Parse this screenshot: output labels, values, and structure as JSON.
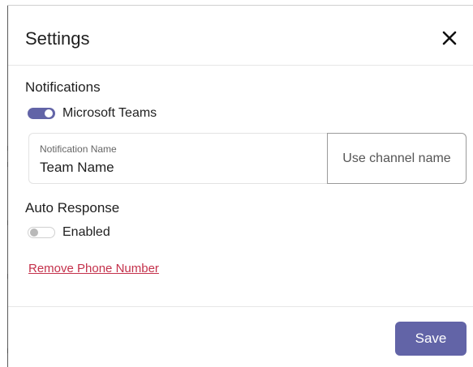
{
  "dialog": {
    "title": "Settings",
    "close_icon": "close-icon"
  },
  "notifications": {
    "heading": "Notifications",
    "teams_toggle": {
      "label": "Microsoft Teams",
      "enabled": true,
      "color": "#6264a7"
    },
    "notification_name": {
      "caption": "Notification Name",
      "value": "Team Name"
    },
    "channel_button_label": "Use channel name"
  },
  "auto_response": {
    "heading": "Auto Response",
    "toggle": {
      "label": "Enabled",
      "enabled": false
    }
  },
  "remove_phone_link": "Remove Phone Number",
  "footer": {
    "save_label": "Save"
  },
  "colors": {
    "accent": "#6264a7",
    "danger_link": "#c4314b"
  }
}
